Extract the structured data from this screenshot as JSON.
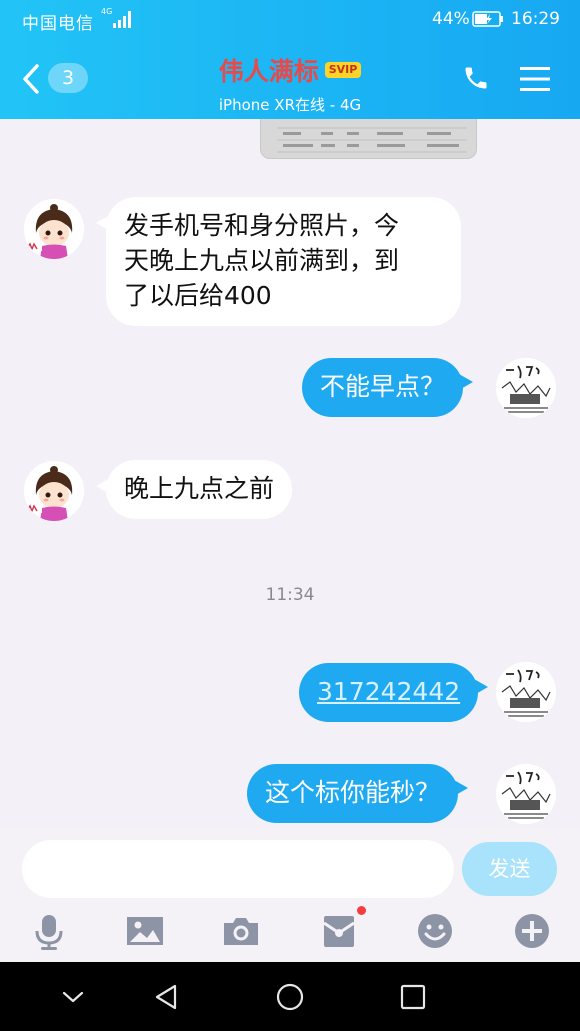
{
  "status_bar": {
    "carrier": "中国电信",
    "network": "4G",
    "battery_percent": "44%",
    "time": "16:29"
  },
  "header": {
    "unread_count": "3",
    "contact_name": "伟人满标",
    "badge": "SVIP",
    "online_status": "iPhone XR在线 - 4G"
  },
  "messages": [
    {
      "from": "contact",
      "text_lines": [
        "发手机号和身分照片，今",
        "天晚上九点以前满到，到",
        "了以后给400"
      ]
    },
    {
      "from": "me",
      "text": "不能早点？"
    },
    {
      "from": "contact",
      "text": "晚上九点之前"
    },
    {
      "timestamp": "11:34"
    },
    {
      "from": "me",
      "text": "317242442",
      "is_link": true
    },
    {
      "from": "me",
      "text": "这个标你能秒？"
    }
  ],
  "input": {
    "value": "",
    "send_label": "发送"
  },
  "toolbar": {
    "items": [
      "microphone-icon",
      "image-icon",
      "camera-icon",
      "red-packet-icon",
      "emoji-icon",
      "plus-icon"
    ]
  },
  "colors": {
    "header_start": "#22c4f6",
    "header_end": "#17a8f2",
    "outgoing_bubble": "#1fa9f0",
    "incoming_bubble": "#ffffff",
    "contact_name": "#e74a4a",
    "svip_badge": "#ffd327",
    "send_button": "#a9e2fb"
  }
}
